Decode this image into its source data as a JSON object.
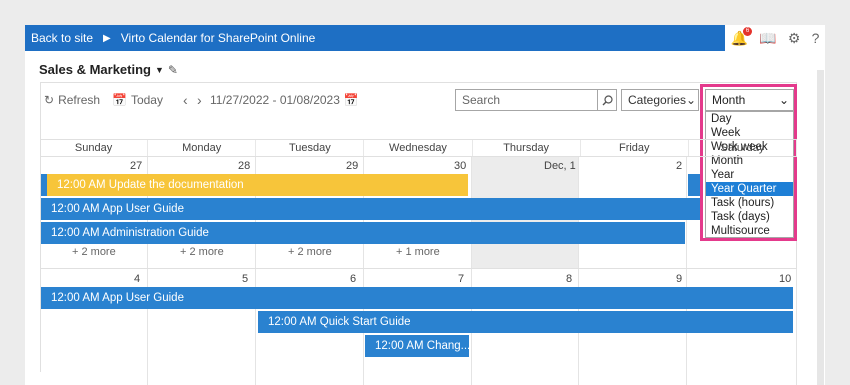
{
  "topbar": {
    "back": "Back to site",
    "title": "Virto Calendar for SharePoint Online",
    "badge": "6"
  },
  "calendar": {
    "title": "Sales & Marketing"
  },
  "toolbar": {
    "refresh": "Refresh",
    "today": "Today",
    "range": "11/27/2022 - 01/08/2023"
  },
  "search": {
    "placeholder": "Search"
  },
  "categories": "Categories",
  "view": {
    "selected": "Month",
    "options": [
      "Day",
      "Week",
      "Work week",
      "Month",
      "Year",
      "Year Quarter",
      "Task (hours)",
      "Task (days)",
      "Multisource"
    ],
    "highlighted": "Year Quarter"
  },
  "days": [
    "Sunday",
    "Monday",
    "Tuesday",
    "Wednesday",
    "Thursday",
    "Friday",
    "Saturday"
  ],
  "week1": {
    "dates": [
      "27",
      "28",
      "29",
      "30",
      "Dec, 1",
      "2",
      ""
    ],
    "events": [
      "12:00 AM Update the documentation",
      "12:00 AM App User Guide",
      "12:00 AM Administration Guide"
    ],
    "more": [
      "+ 2 more",
      "+ 2 more",
      "+ 2 more",
      "+ 1 more"
    ]
  },
  "week2": {
    "dates": [
      "4",
      "5",
      "6",
      "7",
      "8",
      "9",
      "10"
    ],
    "events": [
      "12:00 AM App User Guide",
      "12:00 AM Quick Start Guide",
      "12:00 AM Chang..."
    ]
  },
  "colors": {
    "accent": "#1e6fc4",
    "event_blue": "#2a82d0",
    "event_yellow": "#f7c53a",
    "highlight": "#e43a8c"
  }
}
